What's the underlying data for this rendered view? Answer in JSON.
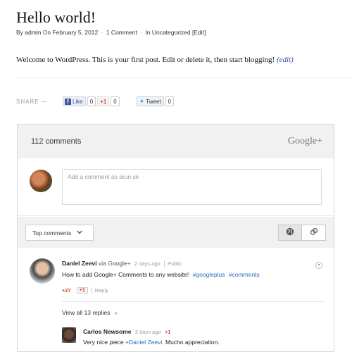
{
  "post": {
    "title": "Hello world!",
    "meta": {
      "by": "By admin",
      "date": "On February 5, 2012",
      "comments": "1 Comment",
      "category": "In Uncategorized",
      "edit": "[Edit]"
    },
    "body": "Welcome to WordPress. This is your first post. Edit or delete it, then start blogging!",
    "edit_link": "(edit)"
  },
  "share": {
    "label": "SHARE —",
    "like_label": "Like",
    "like_count": "0",
    "plusone_label": "+1",
    "plusone_count": "0",
    "tweet_label": "Tweet",
    "tweet_count": "0"
  },
  "gplus": {
    "comment_count": "112 comments",
    "brand": "Google+",
    "compose_placeholder": "Add a comment as arun sk",
    "sort_label": "Top comments",
    "comment": {
      "author": "Daniel Zeevi",
      "via": "via Google+",
      "time": "2 days ago",
      "visibility": "Public",
      "text": "How to add Google+ Comments to any website!",
      "tags": [
        "#googleplus",
        "#comments"
      ],
      "plus_count": "+27",
      "plus_btn": "+1",
      "reply_label": "Reply",
      "view_replies": "View all 13 replies",
      "reply": {
        "author": "Carlos Newsome",
        "time": "2 days ago",
        "plus": "+1",
        "text_before": "Very nice piece",
        "mention": "+Daniel Zeevi.",
        "text_after": "Mucho appreciation."
      }
    }
  },
  "colors": {
    "accent_red": "#d73d32",
    "link_blue": "#2a6dbd",
    "fb_blue": "#3b5998"
  }
}
